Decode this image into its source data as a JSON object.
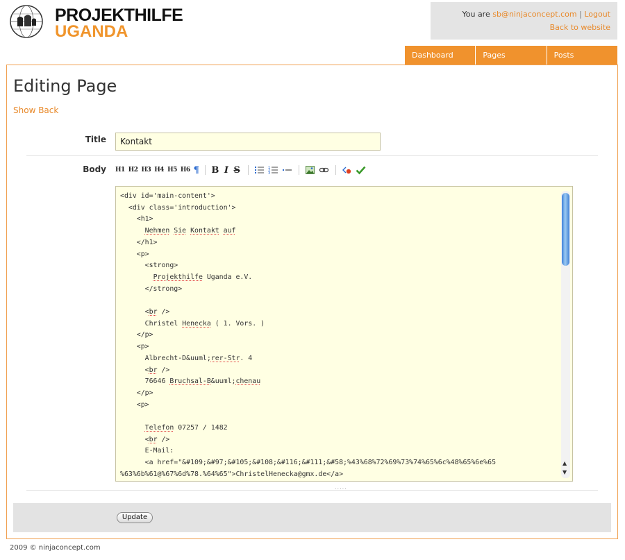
{
  "logo": {
    "line1": "PROJEKTHILFE",
    "line2": "UGANDA"
  },
  "userbox": {
    "you_are": "You are",
    "email": "sb@ninjaconcept.com",
    "separator": "|",
    "logout": "Logout",
    "back": "Back to website"
  },
  "nav": {
    "tabs": [
      {
        "label": "Dashboard"
      },
      {
        "label": "Pages"
      },
      {
        "label": "Posts"
      }
    ]
  },
  "main": {
    "title": "Editing Page",
    "show_back": "Show Back",
    "title_label": "Title",
    "title_value": "Kontakt",
    "body_label": "Body",
    "update_label": "Update"
  },
  "toolbar": {
    "h1": "H1",
    "h2": "H2",
    "h3": "H3",
    "h4": "H4",
    "h5": "H5",
    "h6": "H6",
    "para": "¶",
    "bold": "B",
    "italic": "I",
    "strike": "S"
  },
  "footer": {
    "copyright": "2009  © ninjaconcept.com"
  },
  "colors": {
    "accent": "#f0922d",
    "editor_bg": "#ffffe3"
  },
  "icons": [
    "globe-logo-icon",
    "unordered-list-icon",
    "ordered-list-icon",
    "hr-icon",
    "image-icon",
    "link-icon",
    "html-source-icon",
    "check-icon"
  ]
}
